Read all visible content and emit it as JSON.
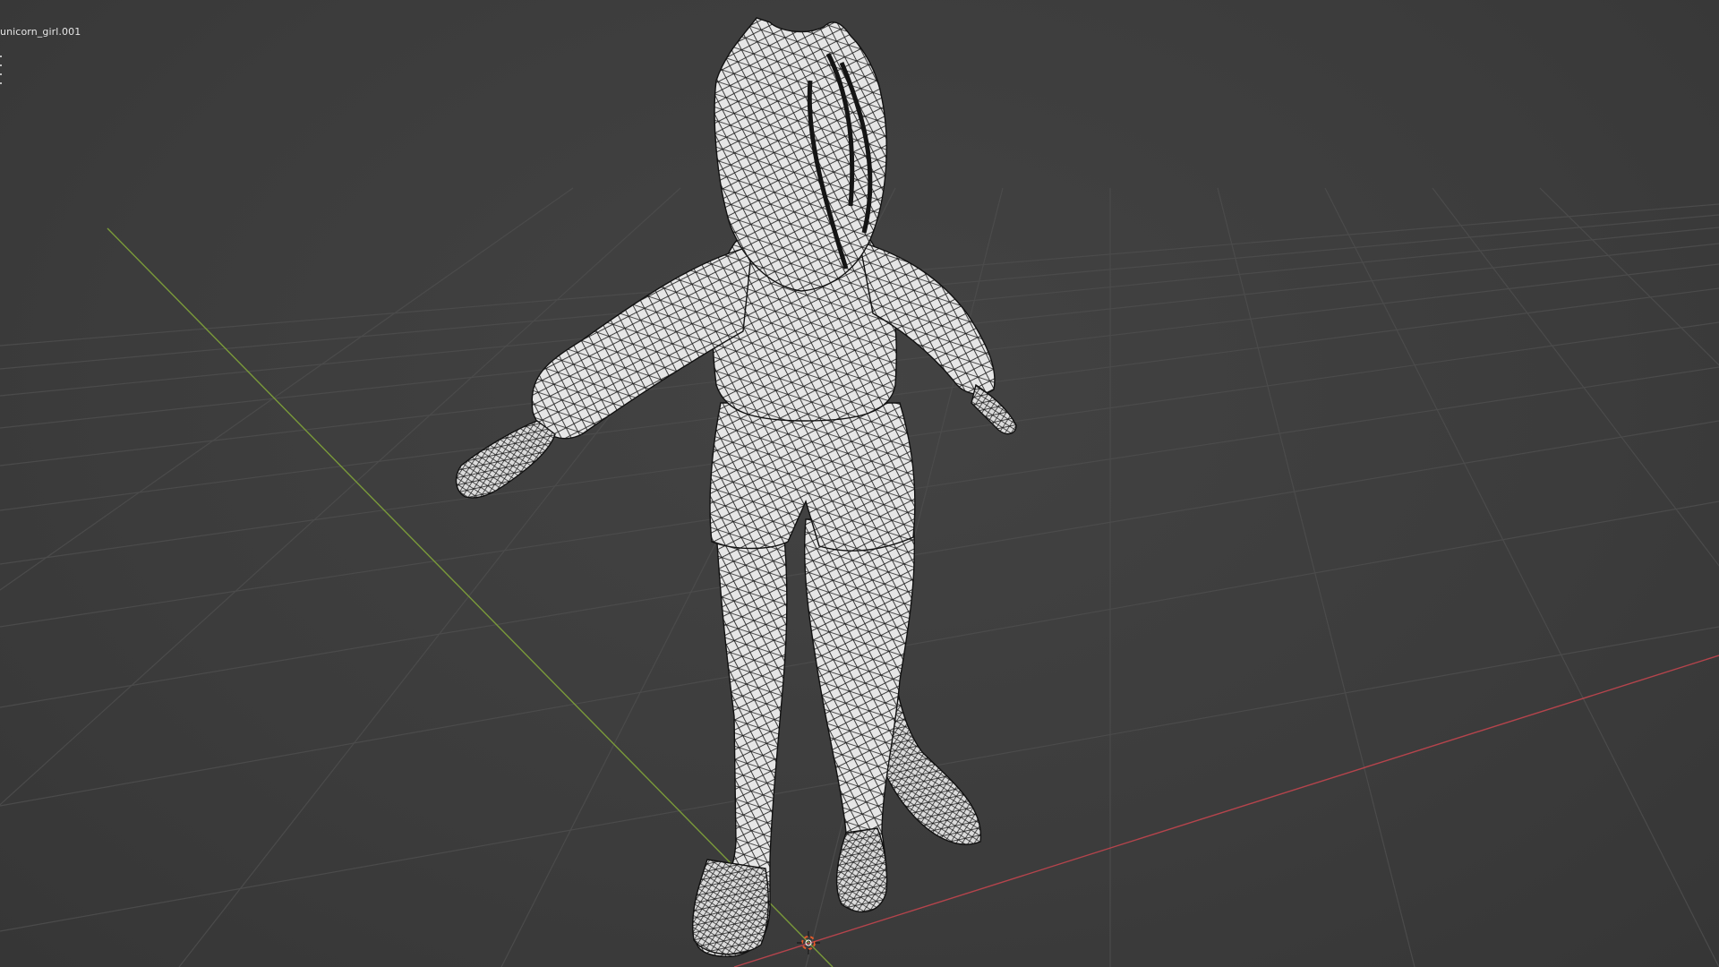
{
  "viewport": {
    "object_name": "unicorn_girl.001",
    "shading": "wireframe",
    "background_color": "#3d3d3d",
    "grid_color": "#4a4a4a",
    "x_axis_color": "#b5444c",
    "y_axis_color": "#7a9a3a",
    "mesh_color": "#e9e9e9",
    "mesh_edge_color": "#1b1b1b"
  },
  "icons": {
    "origin": "origin-cursor-icon"
  }
}
